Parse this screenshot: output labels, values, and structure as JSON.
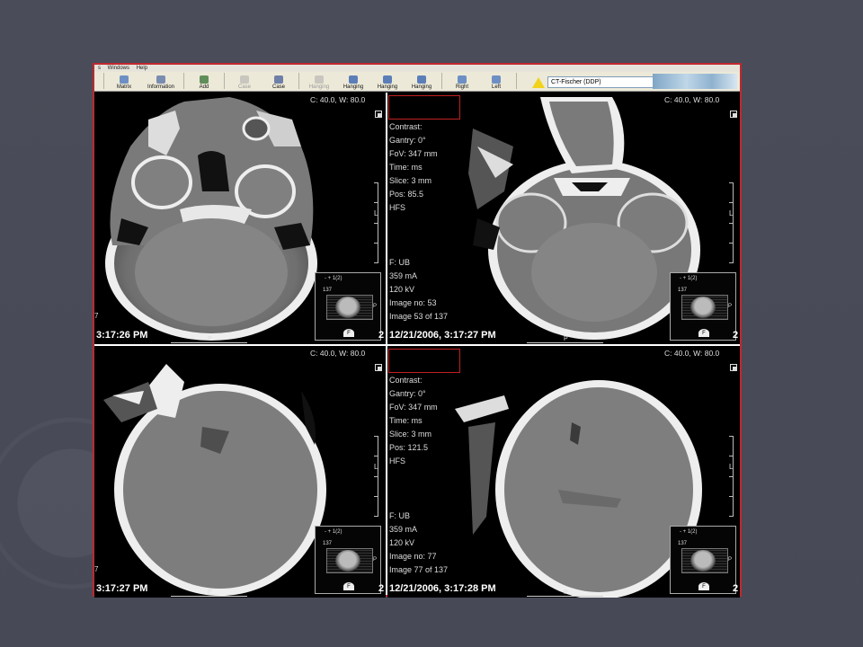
{
  "menubar": {
    "items": [
      "s",
      "Windows",
      "Help"
    ]
  },
  "toolbar": {
    "buttons": [
      {
        "label": "Matrix",
        "icon": "matrix-icon",
        "disabled": false
      },
      {
        "label": "Information",
        "icon": "information-icon",
        "disabled": false
      },
      {
        "label": "Add",
        "icon": "add-icon",
        "disabled": false
      },
      {
        "label": "Case",
        "icon": "case-prev-icon",
        "disabled": true
      },
      {
        "label": "Case",
        "icon": "case-next-icon",
        "disabled": false
      },
      {
        "label": "Hanging",
        "icon": "hanging-icon",
        "disabled": true
      },
      {
        "label": "Hanging",
        "icon": "hanging-icon",
        "disabled": false
      },
      {
        "label": "Hanging",
        "icon": "hanging-icon",
        "disabled": false
      },
      {
        "label": "Hanging",
        "icon": "hanging-icon",
        "disabled": false
      },
      {
        "label": "Right",
        "icon": "rotate-right-icon",
        "disabled": false
      },
      {
        "label": "Left",
        "icon": "rotate-left-icon",
        "disabled": false
      }
    ],
    "preset_value": "CT-Fischer (DDP)"
  },
  "colors": {
    "frame": "#c0282e",
    "toolbar": "#ece9d8",
    "slide_bg": "#4b4d5a"
  },
  "viewports": {
    "tl": {
      "wl": "C:  40.0, W:  80.0",
      "orient_right": "L",
      "orient_left": "7",
      "timestamp": "3:17:26 PM",
      "scout_header": "-  +  1(2)",
      "scout_num": "137",
      "scout_p": "P",
      "scout_f": "F",
      "bottom_p": "P",
      "edge_num": "2"
    },
    "tr": {
      "wl": "C:  40.0, W:  80.0",
      "info": [
        "Contrast:",
        "Gantry: 0°",
        "FoV: 347 mm",
        "Time:  ms",
        "Slice: 3 mm",
        "Pos: 85.5",
        "HFS"
      ],
      "info_bottom": [
        "F: UB",
        "359 mA",
        "120 kV",
        "Image no: 53",
        "Image 53 of 137"
      ],
      "orient_right": "L",
      "timestamp": "12/21/2006, 3:17:27 PM",
      "scout_header": "-  +  1(2)",
      "scout_num": "137",
      "scout_p": "P",
      "scout_f": "F",
      "bottom_p": "P",
      "edge_num": "2"
    },
    "bl": {
      "wl": "C:  40.0, W:  80.0",
      "orient_right": "L",
      "orient_left": "7",
      "timestamp": "3:17:27 PM",
      "scout_header": "-  +  1(2)",
      "scout_num": "137",
      "scout_p": "P",
      "scout_f": "F",
      "bottom_p": "P",
      "edge_num": "2"
    },
    "br": {
      "wl": "C:  40.0, W:  80.0",
      "info": [
        "Contrast:",
        "Gantry: 0°",
        "FoV: 347 mm",
        "Time:  ms",
        "Slice: 3 mm",
        "Pos: 121.5",
        "HFS"
      ],
      "info_bottom": [
        "F: UB",
        "359 mA",
        "120 kV",
        "Image no: 77",
        "Image 77 of 137"
      ],
      "orient_right": "L",
      "timestamp": "12/21/2006, 3:17:28 PM",
      "scout_header": "-  +  1(2)",
      "scout_num": "137",
      "scout_p": "P",
      "scout_f": "F",
      "bottom_p": "P",
      "edge_num": "2"
    }
  }
}
